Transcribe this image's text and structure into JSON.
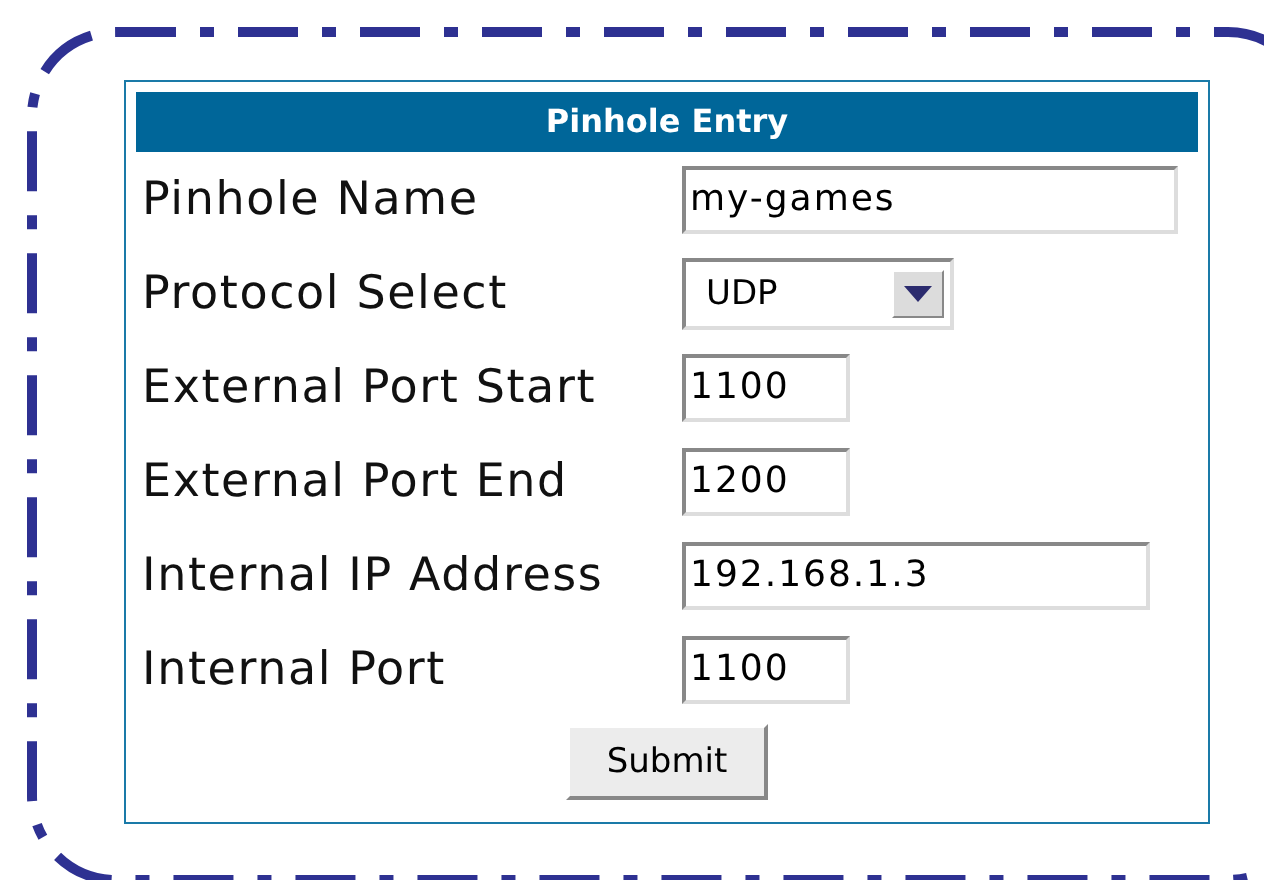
{
  "panel": {
    "title": "Pinhole Entry",
    "fields": [
      {
        "label": "Pinhole Name",
        "kind": "name",
        "value": "my-games"
      },
      {
        "label": "Protocol Select",
        "kind": "select",
        "value": "UDP"
      },
      {
        "label": "External Port Start",
        "kind": "port",
        "value": "1100"
      },
      {
        "label": "External Port End",
        "kind": "port",
        "value": "1200"
      },
      {
        "label": "Internal IP Address",
        "kind": "address",
        "value": "192.168.1.3"
      },
      {
        "label": "Internal Port",
        "kind": "port",
        "value": "1100"
      }
    ],
    "submit": "Submit"
  }
}
